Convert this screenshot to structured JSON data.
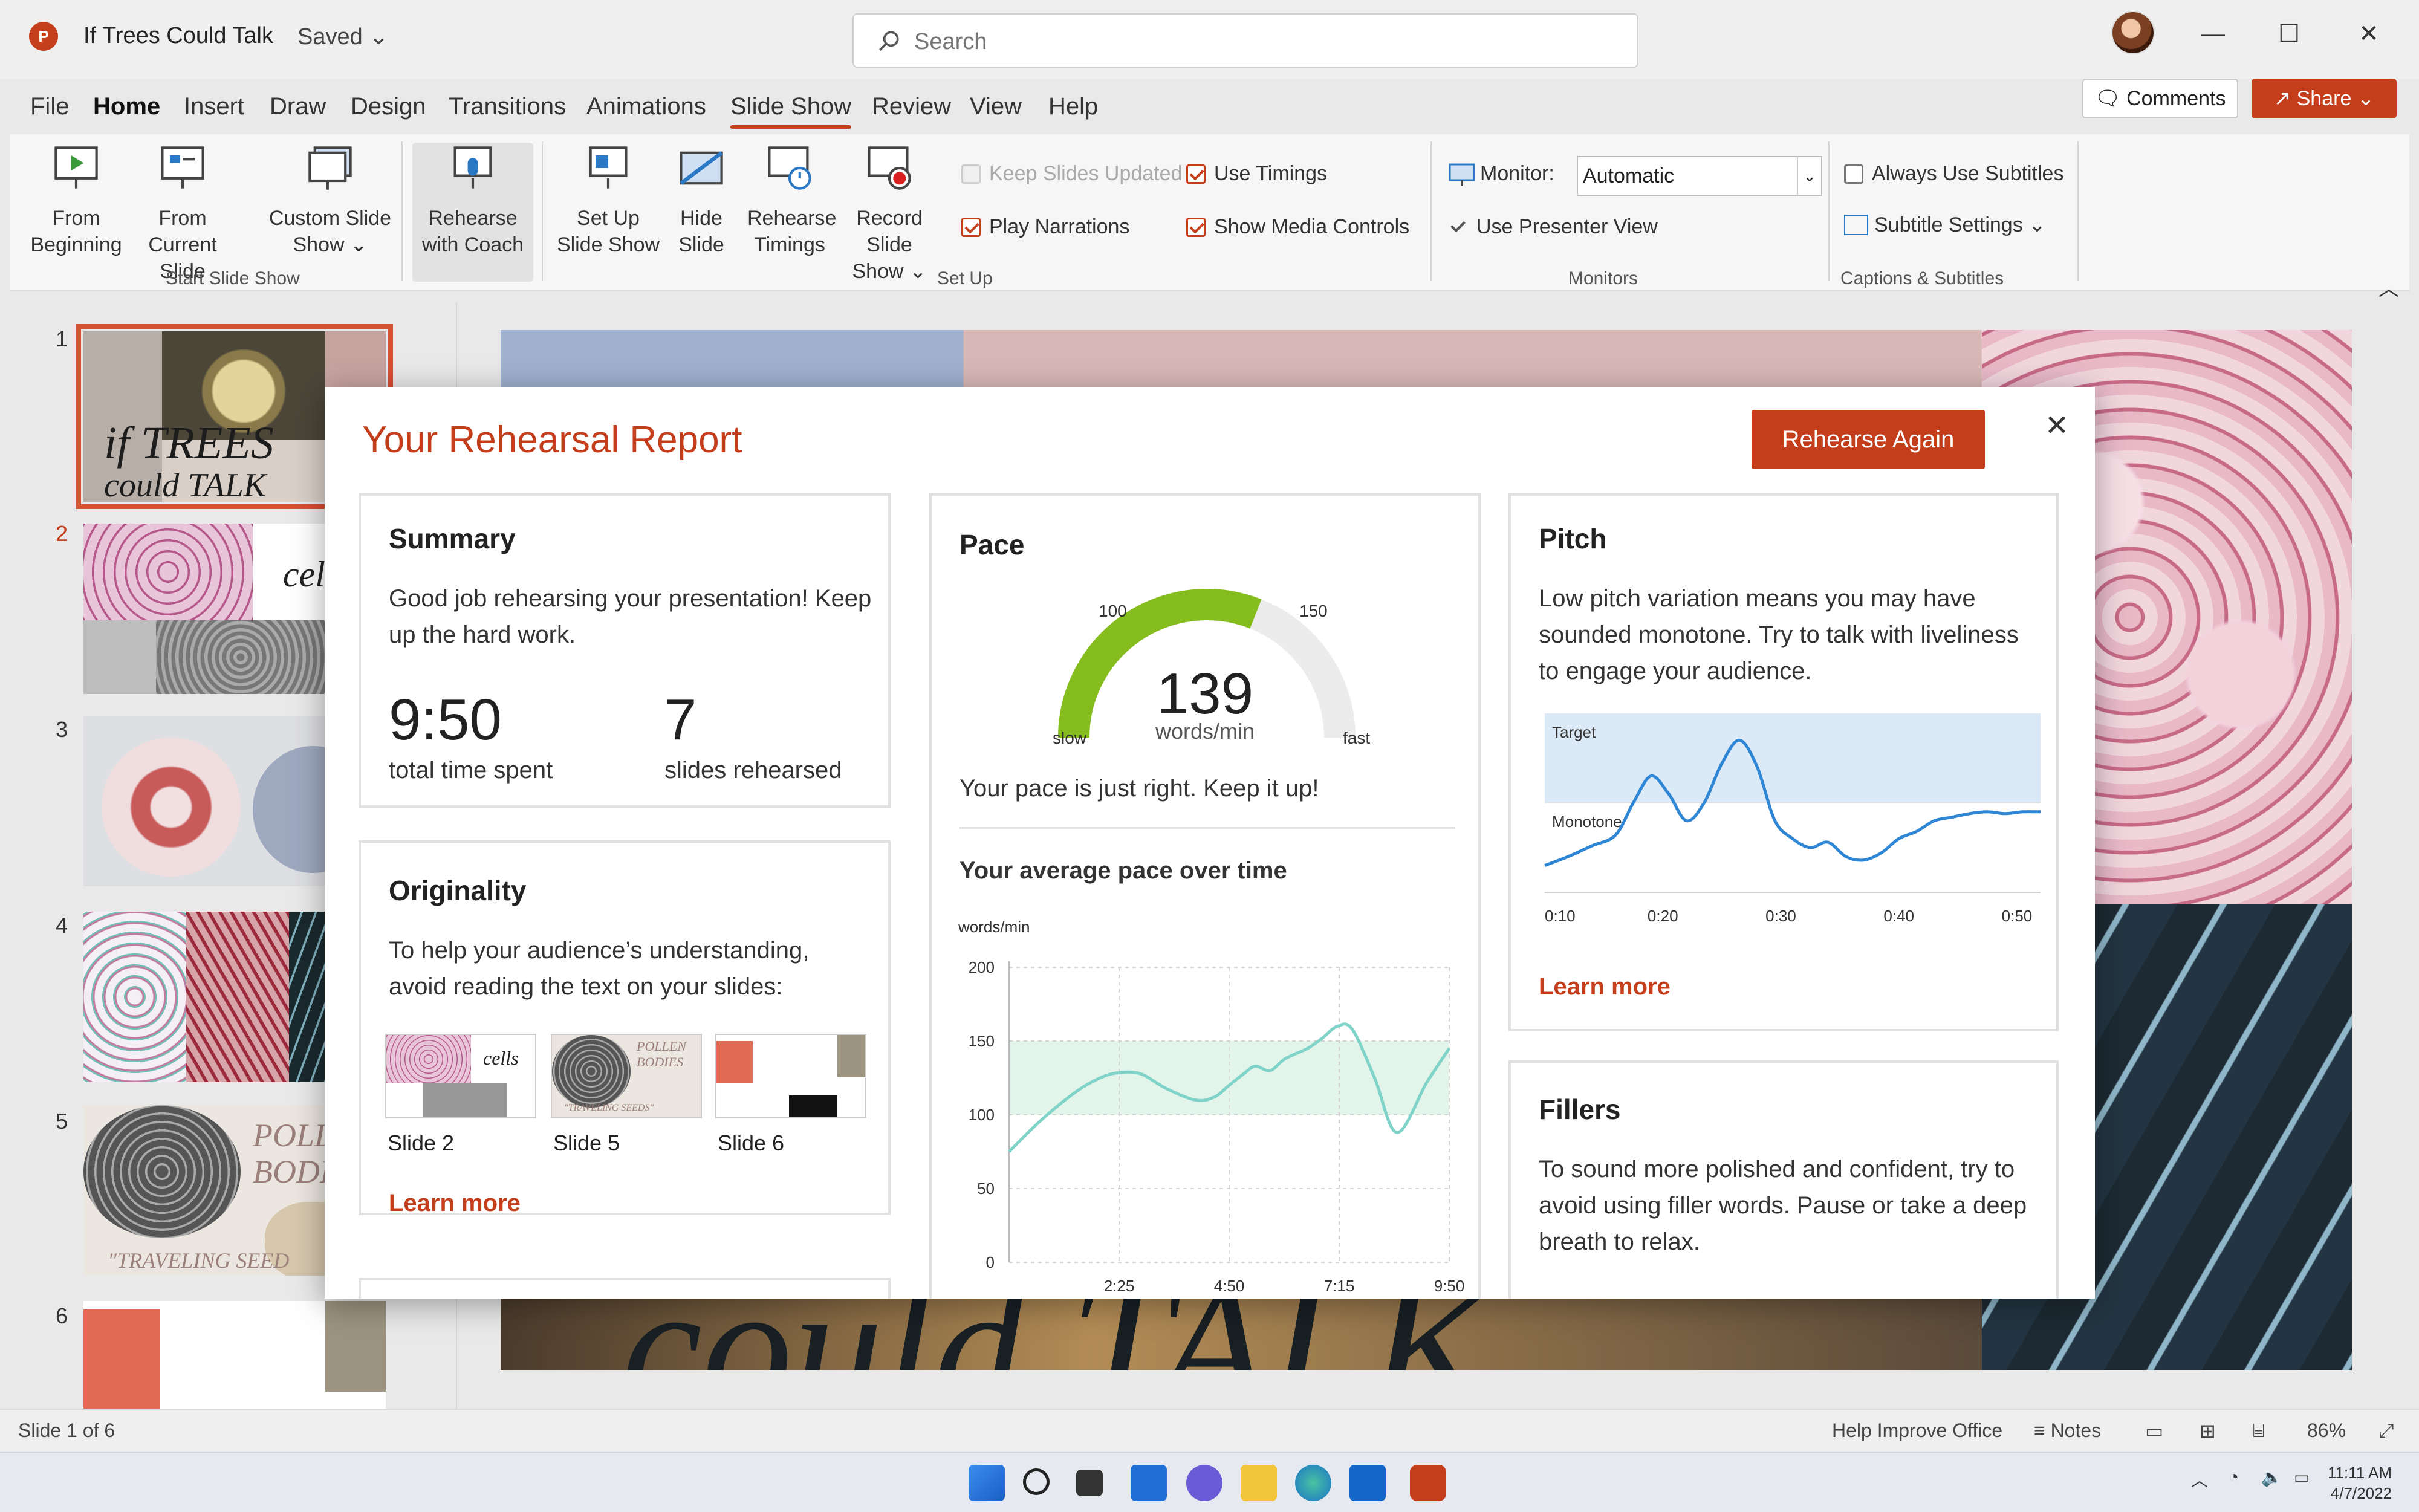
{
  "app": {
    "icon_letter": "P",
    "title": "If Trees Could Talk",
    "status": "Saved"
  },
  "search": {
    "placeholder": "Search"
  },
  "window": {
    "minimize": "—",
    "maximize": "☐",
    "close": "✕"
  },
  "menu": {
    "tabs": [
      "File",
      "Home",
      "Insert",
      "Draw",
      "Design",
      "Transitions",
      "Animations",
      "Slide Show",
      "Review",
      "View",
      "Help"
    ],
    "active": "Slide Show"
  },
  "header_actions": {
    "comments": "Comments",
    "share": "Share"
  },
  "ribbon": {
    "start_group": {
      "label": "Start Slide Show",
      "from_beginning": [
        "From",
        "Beginning"
      ],
      "from_current": [
        "From",
        "Current Slide"
      ],
      "custom": [
        "Custom Slide",
        "Show ⌄"
      ]
    },
    "rehearse_coach": [
      "Rehearse",
      "with Coach"
    ],
    "setup_group": {
      "label": "Set Up",
      "set_up": [
        "Set Up",
        "Slide Show"
      ],
      "hide": [
        "Hide",
        "Slide"
      ],
      "rehearse_timings": [
        "Rehearse",
        "Timings"
      ],
      "record": [
        "Record Slide",
        "Show ⌄"
      ],
      "keep_updated": "Keep Slides Updated",
      "play_narrations": "Play Narrations",
      "use_timings": "Use Timings",
      "show_media": "Show Media Controls"
    },
    "monitors_group": {
      "label": "Monitors",
      "monitor_label": "Monitor:",
      "monitor_value": "Automatic",
      "presenter_view": "Use Presenter View"
    },
    "captions_group": {
      "label": "Captions & Subtitles",
      "always_subtitles": "Always Use Subtitles",
      "subtitle_settings": "Subtitle Settings ⌄"
    }
  },
  "thumbnails": {
    "numbers": [
      "1",
      "2",
      "3",
      "4",
      "5",
      "6"
    ],
    "slide1_title": [
      "if TREES",
      "could TALK"
    ],
    "slide2_text": "cel",
    "slide5_text": [
      "POLL",
      "BODI",
      "\"TRAVELING SEED"
    ]
  },
  "slide": {
    "bottom_text": "could TALK"
  },
  "report": {
    "title": "Your Rehearsal Report",
    "rehearse_again": "Rehearse Again",
    "close": "✕",
    "summary": {
      "title": "Summary",
      "text": "Good job rehearsing your presentation! Keep up the hard work.",
      "time_value": "9:50",
      "time_label": "total time spent",
      "slides_value": "7",
      "slides_label": "slides rehearsed"
    },
    "originality": {
      "title": "Originality",
      "text": "To help your audience’s understanding, avoid reading the text on your slides:",
      "slides": [
        "Slide 2",
        "Slide 5",
        "Slide 6"
      ],
      "thumb_text": [
        "cells",
        "POLLEN BODIES",
        "\"TRAVELING SEEDS\""
      ],
      "learn_more": "Learn more"
    },
    "pace": {
      "title": "Pace",
      "value": "139",
      "unit": "words/min",
      "gauge_min_label": "slow",
      "gauge_max_label": "fast",
      "gauge_tick_low": "100",
      "gauge_tick_high": "150",
      "gauge_fraction": 0.62,
      "message": "Your pace is just right. Keep it up!",
      "subtitle": "Your average pace over time"
    },
    "pitch": {
      "title": "Pitch",
      "text": "Low pitch variation means you may have sounded monotone. Try to talk with liveliness to engage your audience.",
      "target_label": "Target",
      "monotone_label": "Monotone",
      "learn_more": "Learn more"
    },
    "fillers": {
      "title": "Fillers",
      "text": "To sound more polished and confident, try to avoid using filler words. Pause or take a deep breath to relax."
    }
  },
  "chart_data": [
    {
      "type": "line",
      "ylabel": "words/min",
      "xticks": [
        "2:25",
        "4:50",
        "7:15",
        "9:50"
      ],
      "yticks": [
        0,
        50,
        100,
        150,
        200
      ],
      "ylim": [
        0,
        200
      ],
      "x_seconds_max": 590,
      "target_band": [
        100,
        150
      ],
      "grid": true,
      "series": [
        {
          "x": [
            0,
            40,
            80,
            110,
            140,
            175,
            210,
            250,
            275,
            295,
            315,
            330,
            350,
            370,
            400,
            420,
            440,
            460,
            490,
            520,
            560,
            590
          ],
          "values": [
            75,
            95,
            112,
            122,
            128,
            128,
            118,
            110,
            112,
            120,
            128,
            133,
            130,
            138,
            145,
            152,
            160,
            158,
            125,
            88,
            122,
            145
          ]
        }
      ]
    },
    {
      "type": "line",
      "xticks": [
        "0:10",
        "0:20",
        "0:30",
        "0:40",
        "0:50"
      ],
      "xlim": [
        10,
        52
      ],
      "bands": [
        "Target",
        "Monotone"
      ],
      "grid": true,
      "series": [
        {
          "x": [
            10,
            12,
            14,
            16,
            17.5,
            19,
            20.5,
            22,
            23.5,
            25,
            26.5,
            28,
            29.5,
            31,
            32.5,
            34,
            35.5,
            37,
            38.5,
            40,
            41.5,
            43,
            44.5,
            46,
            47.5,
            49,
            50.5,
            52
          ],
          "values": [
            0.15,
            0.2,
            0.26,
            0.32,
            0.5,
            0.65,
            0.55,
            0.4,
            0.5,
            0.72,
            0.85,
            0.7,
            0.4,
            0.3,
            0.25,
            0.28,
            0.2,
            0.18,
            0.22,
            0.3,
            0.34,
            0.4,
            0.42,
            0.44,
            0.45,
            0.44,
            0.45,
            0.45
          ]
        }
      ]
    }
  ],
  "statusbar": {
    "slide_info": "Slide 1 of 6",
    "help_improve": "Help Improve Office",
    "notes": "Notes",
    "zoom": "86%"
  },
  "taskbar": {
    "time": "11:11 AM",
    "date": "4/7/2022"
  }
}
